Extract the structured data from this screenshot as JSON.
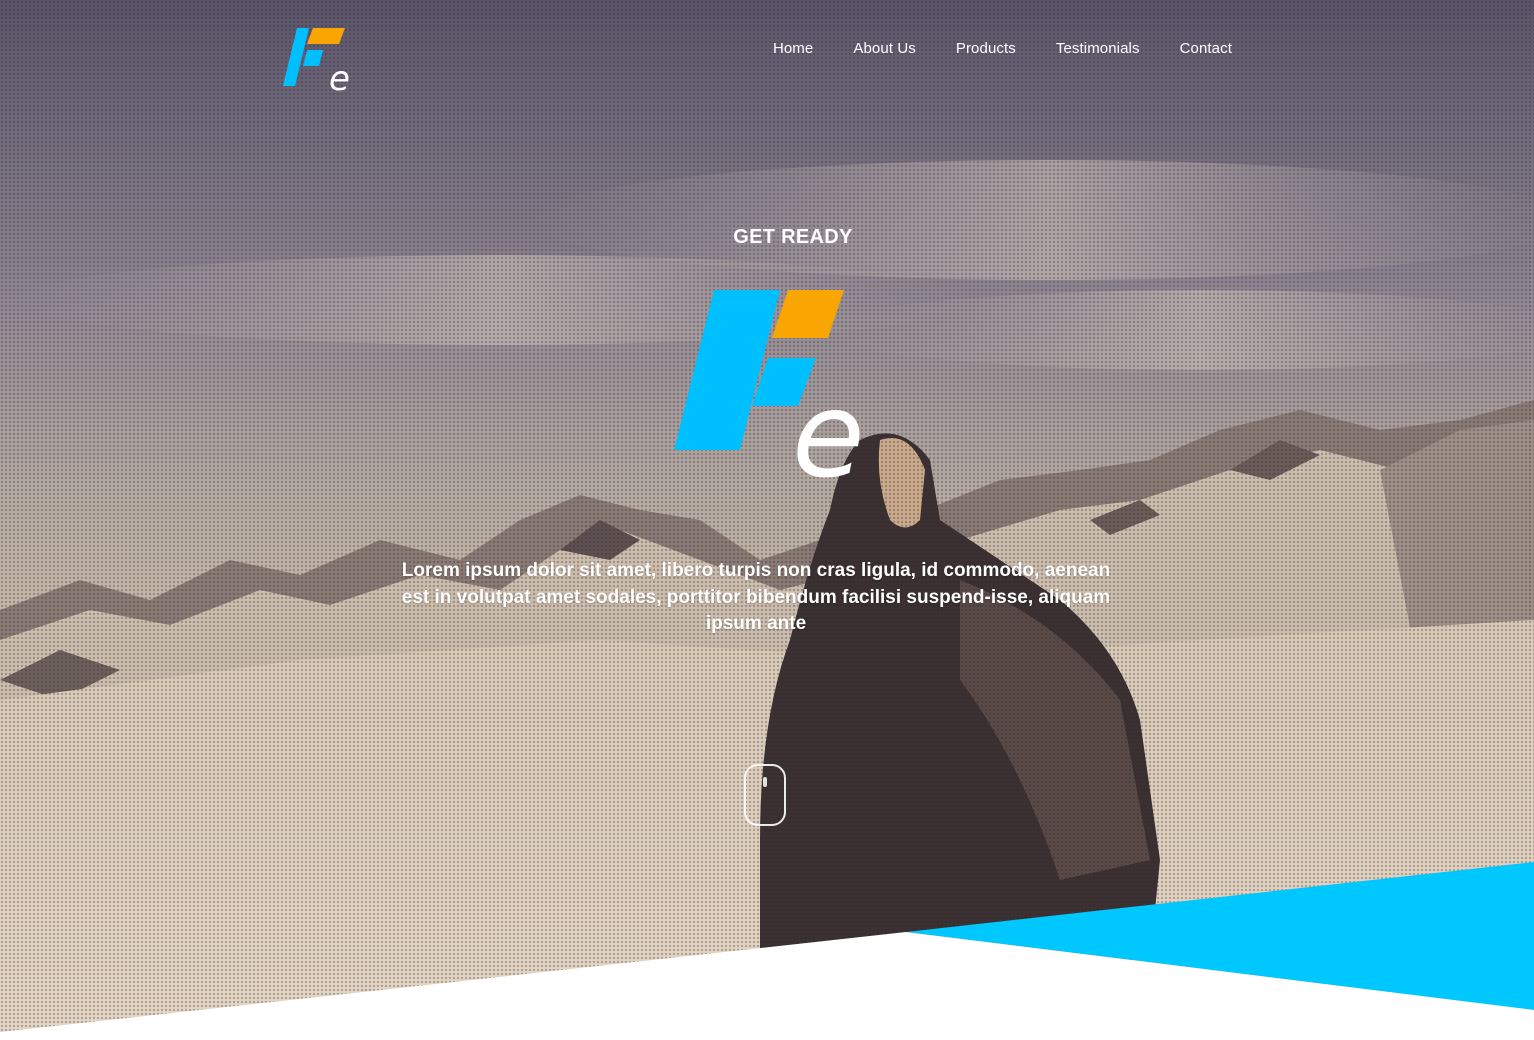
{
  "brand": {
    "logo_icon": "fe-logo-icon",
    "colors": {
      "blue": "#00bfff",
      "orange": "#f9a602",
      "white": "#ffffff",
      "accent_band": "#00c8ff"
    }
  },
  "nav": {
    "items": [
      {
        "label": "Home"
      },
      {
        "label": "About Us"
      },
      {
        "label": "Products"
      },
      {
        "label": "Testimonials"
      },
      {
        "label": "Contact"
      }
    ]
  },
  "hero": {
    "eyebrow": "GET READY",
    "lead": "Lorem ipsum dolor sit amet, libero turpis non cras ligula, id commodo, aenean est in volutpat amet sodales, porttitor bibendum facilisi suspend-isse, aliquam ipsum ante",
    "scroll_icon": "mouse-scroll-icon"
  }
}
